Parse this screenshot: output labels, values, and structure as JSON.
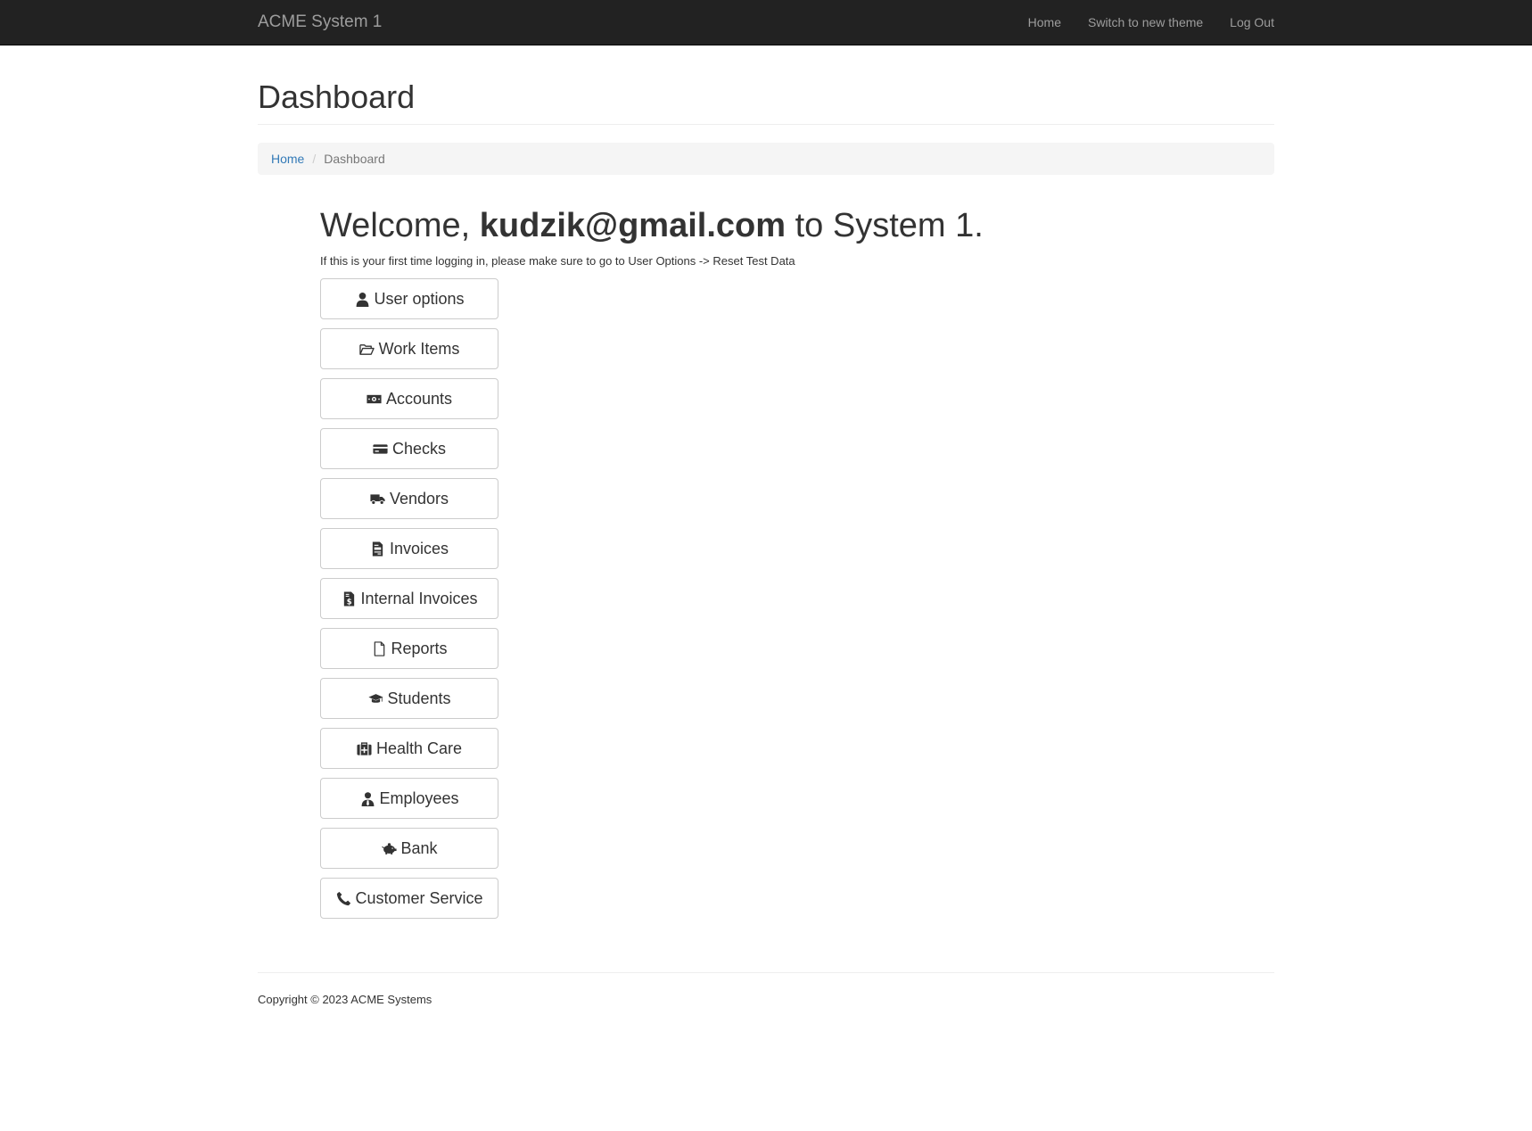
{
  "navbar": {
    "brand": "ACME System 1",
    "links": [
      {
        "label": "Home"
      },
      {
        "label": "Switch to new theme"
      },
      {
        "label": "Log Out"
      }
    ]
  },
  "page": {
    "title": "Dashboard"
  },
  "breadcrumb": {
    "home": "Home",
    "separator": "/",
    "current": "Dashboard"
  },
  "welcome": {
    "prefix": "Welcome, ",
    "user": "kudzik@gmail.com",
    "suffix": " to System 1.",
    "note": "If this is your first time logging in, please make sure to go to User Options -> Reset Test Data"
  },
  "buttons": [
    {
      "label": "User options",
      "icon": "user-icon"
    },
    {
      "label": "Work Items",
      "icon": "folder-open-icon"
    },
    {
      "label": "Accounts",
      "icon": "money-bill-icon"
    },
    {
      "label": "Checks",
      "icon": "credit-card-icon"
    },
    {
      "label": "Vendors",
      "icon": "truck-icon"
    },
    {
      "label": "Invoices",
      "icon": "file-invoice-icon"
    },
    {
      "label": "Internal Invoices",
      "icon": "file-invoice-dollar-icon"
    },
    {
      "label": "Reports",
      "icon": "file-icon"
    },
    {
      "label": "Students",
      "icon": "graduation-cap-icon"
    },
    {
      "label": "Health Care",
      "icon": "medkit-icon"
    },
    {
      "label": "Employees",
      "icon": "user-tie-icon"
    },
    {
      "label": "Bank",
      "icon": "piggy-bank-icon"
    },
    {
      "label": "Customer Service",
      "icon": "phone-icon"
    }
  ],
  "footer": {
    "copyright": "Copyright © 2023 ACME Systems"
  },
  "colors": {
    "navbar_bg": "#222222",
    "navbar_text": "#9d9d9d",
    "link": "#337ab7",
    "breadcrumb_bg": "#f5f5f5",
    "button_border": "#cccccc"
  }
}
